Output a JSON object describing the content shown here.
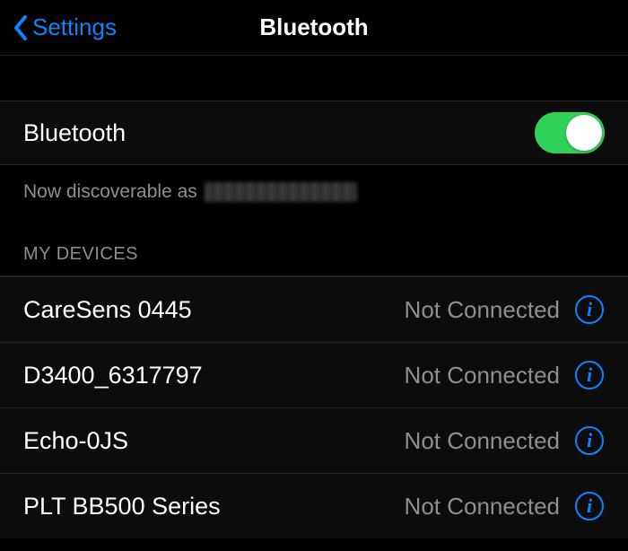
{
  "nav": {
    "back_label": "Settings",
    "title": "Bluetooth"
  },
  "toggle": {
    "label": "Bluetooth",
    "on": true
  },
  "discoverable_prefix": "Now discoverable as",
  "section_header": "MY DEVICES",
  "status_not_connected": "Not Connected",
  "devices": [
    {
      "name": "CareSens 0445",
      "status": "Not Connected"
    },
    {
      "name": "D3400_6317797",
      "status": "Not Connected"
    },
    {
      "name": "Echo-0JS",
      "status": "Not Connected"
    },
    {
      "name": "PLT BB500 Series",
      "status": "Not Connected"
    }
  ],
  "colors": {
    "accent": "#0a84ff",
    "switch_on": "#30d158",
    "secondary_text": "#8e8e93"
  }
}
